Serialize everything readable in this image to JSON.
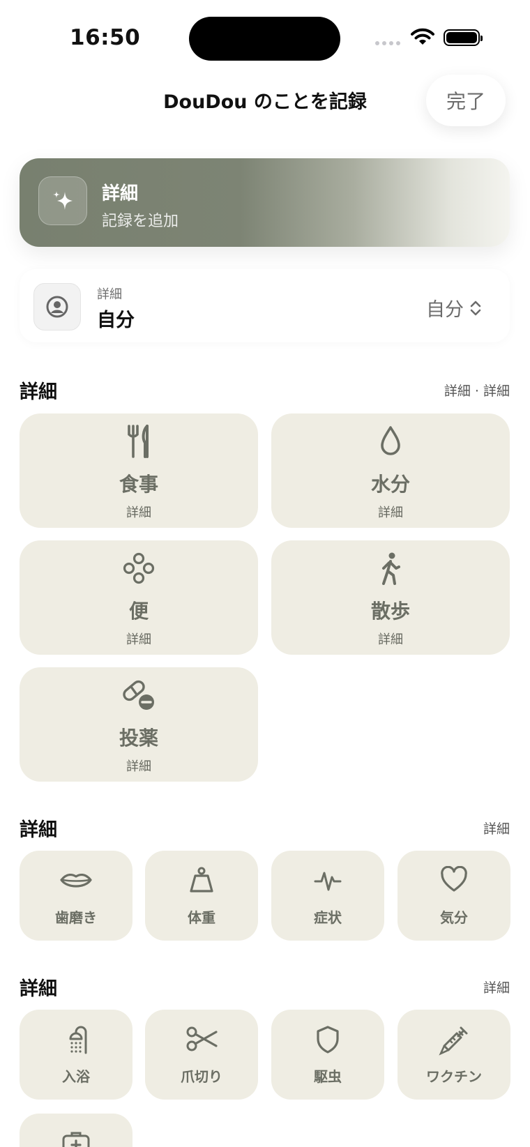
{
  "status": {
    "time": "16:50"
  },
  "nav": {
    "title": "DouDou のことを記録",
    "done_label": "完了"
  },
  "hero": {
    "title": "詳細",
    "subtitle": "記録を追加",
    "icon": "sparkles-icon"
  },
  "profile": {
    "label": "詳細",
    "name": "自分",
    "selected": "自分",
    "icon": "person-circle-icon"
  },
  "sections": [
    {
      "title": "詳細",
      "meta": "詳細 · 詳細",
      "items": [
        {
          "label": "食事",
          "sub": "詳細",
          "icon": "fork-knife-icon"
        },
        {
          "label": "水分",
          "sub": "詳細",
          "icon": "drop-icon"
        },
        {
          "label": "便",
          "sub": "詳細",
          "icon": "circles-icon"
        },
        {
          "label": "散歩",
          "sub": "詳細",
          "icon": "walk-icon"
        },
        {
          "label": "投薬",
          "sub": "詳細",
          "icon": "pills-icon"
        }
      ]
    },
    {
      "title": "詳細",
      "meta": "詳細",
      "items": [
        {
          "label": "歯磨き",
          "icon": "mouth-icon"
        },
        {
          "label": "体重",
          "icon": "scale-icon"
        },
        {
          "label": "症状",
          "icon": "waveform-icon"
        },
        {
          "label": "気分",
          "icon": "heart-icon"
        }
      ]
    },
    {
      "title": "詳細",
      "meta": "詳細",
      "items": [
        {
          "label": "入浴",
          "icon": "shower-icon"
        },
        {
          "label": "爪切り",
          "icon": "scissors-icon"
        },
        {
          "label": "駆虫",
          "icon": "shield-icon"
        },
        {
          "label": "ワクチン",
          "icon": "syringe-icon"
        },
        {
          "label": "",
          "icon": "first-aid-kit-icon"
        }
      ]
    }
  ],
  "colors": {
    "tile_bg": "#efede3",
    "icon": "#6b6e64",
    "hero_start": "#78806f"
  }
}
